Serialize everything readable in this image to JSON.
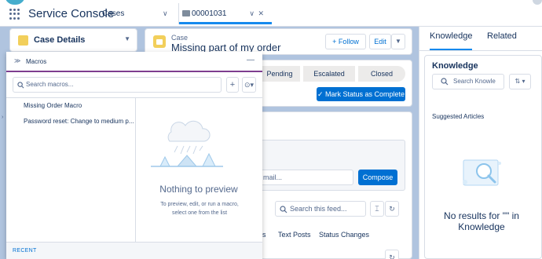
{
  "nav": {
    "app_name": "Service Console",
    "tabs": [
      {
        "label": "Cases"
      },
      {
        "label": "00001031"
      }
    ]
  },
  "case_details": {
    "title": "Case Details"
  },
  "case_header": {
    "object_label": "Case",
    "subject": "Missing part of my order",
    "follow_label": "Follow",
    "edit_label": "Edit"
  },
  "path": {
    "stages": [
      "Pending",
      "Escalated",
      "Closed"
    ],
    "mark_complete_label": "Mark Status as Complete"
  },
  "feed": {
    "email_placeholder": "mail...",
    "compose_label": "Compose",
    "search_placeholder": "Search this feed...",
    "tabs": [
      "s",
      "Text Posts",
      "Status Changes"
    ]
  },
  "right_panel": {
    "tabs": [
      "Knowledge",
      "Related"
    ],
    "title": "Knowledge",
    "search_placeholder": "Search Knowle",
    "suggested_label": "Suggested Articles",
    "empty_message": "No results for \"\" in Knowledge"
  },
  "macros": {
    "title": "Macros",
    "search_placeholder": "Search macros...",
    "items": [
      "Missing Order Macro",
      "Password reset: Change to medium p..."
    ],
    "preview_title": "Nothing to preview",
    "preview_subtitle": "To preview, edit, or run a macro, select one from the list",
    "recent_label": "RECENT"
  },
  "colors": {
    "brand": "#0070d2",
    "accent_tab": "#1589ee",
    "macro_header": "#7e3e8f",
    "case_icon": "#f2cf5b",
    "background": "#b0c4df"
  }
}
